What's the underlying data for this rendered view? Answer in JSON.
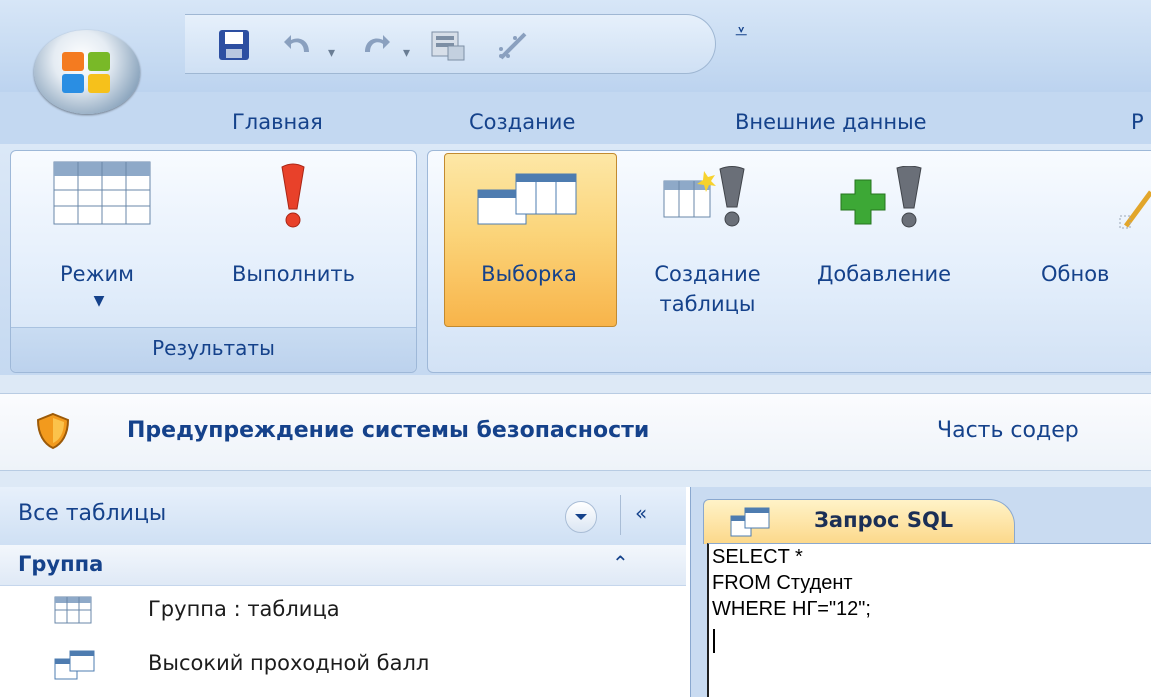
{
  "ribbon_tabs": [
    "Главная",
    "Создание",
    "Внешние данные",
    "Р"
  ],
  "groups": {
    "results": {
      "caption": "Результаты",
      "buttons": [
        {
          "label": "Режим",
          "icon": "datasheet-view-icon",
          "has_dropdown": true
        },
        {
          "label": "Выполнить",
          "icon": "run-exclamation-icon"
        }
      ]
    },
    "query_type": {
      "buttons": [
        {
          "label": "Выборка",
          "icon": "select-query-icon",
          "selected": true
        },
        {
          "label_line1": "Создание",
          "label_line2": "таблицы",
          "icon": "make-table-icon"
        },
        {
          "label": "Добавление",
          "icon": "append-query-icon"
        },
        {
          "label": "Обнов",
          "icon": "update-query-icon"
        }
      ]
    }
  },
  "security_bar": {
    "title": "Предупреждение системы безопасности",
    "message": "Часть содер",
    "icon": "shield-icon"
  },
  "navigation_pane": {
    "header": "Все таблицы",
    "group": "Группа",
    "items": [
      {
        "label": "Группа : таблица",
        "icon": "table-icon"
      },
      {
        "label": "Высокий проходной балл",
        "icon": "query-icon"
      }
    ]
  },
  "document": {
    "tab_label": "Запрос SQL",
    "sql_lines": [
      "SELECT *",
      "FROM Студент",
      "WHERE НГ=\"12\";"
    ]
  },
  "colors": {
    "ribbon_text": "#15428b",
    "selected_button": "#fbd57b",
    "exclamation": "#e8412a",
    "plus": "#3da836"
  }
}
